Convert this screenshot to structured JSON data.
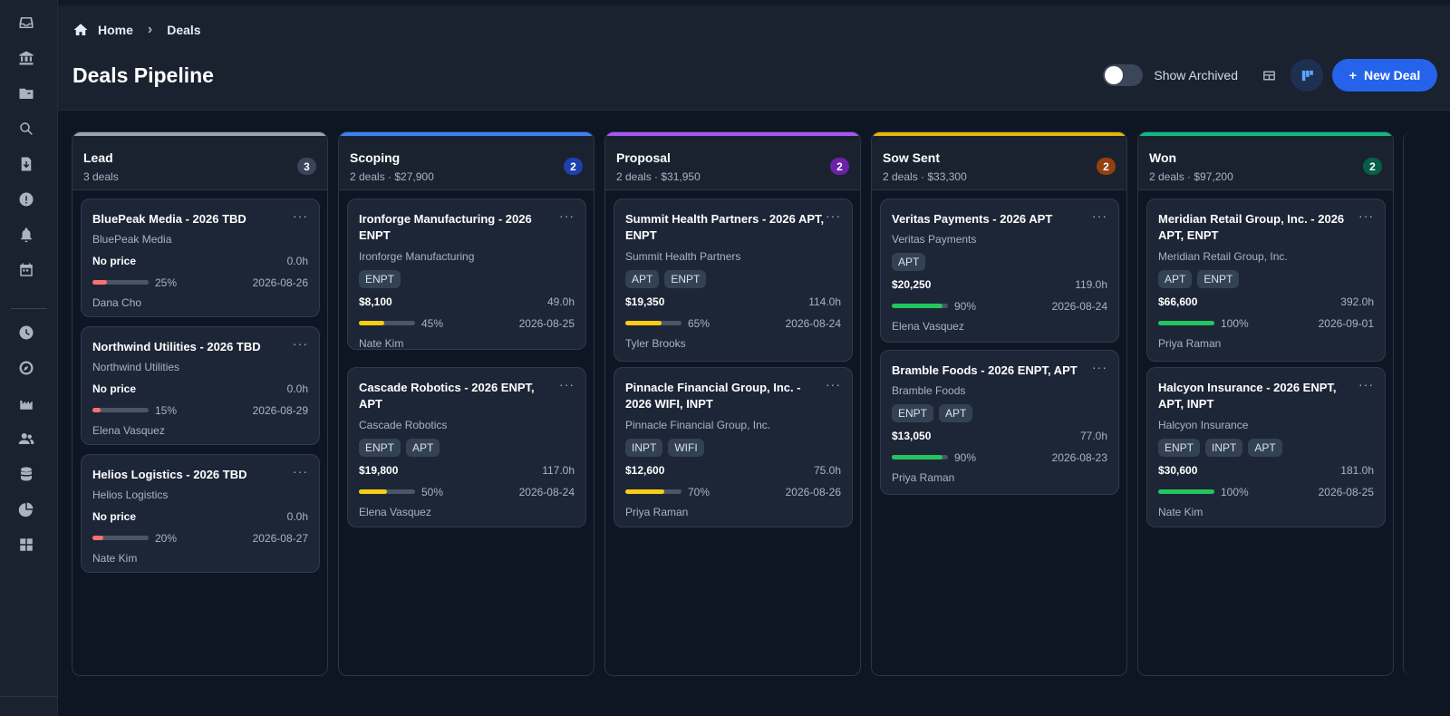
{
  "breadcrumb": {
    "home": "Home",
    "current": "Deals"
  },
  "page_title": "Deals Pipeline",
  "toolbar": {
    "show_archived": "Show Archived",
    "new_deal": "New Deal"
  },
  "columns": [
    {
      "title": "Lead",
      "meta": "3 deals",
      "count": "3",
      "accent": "#9aa3af",
      "badge": "#3b4658",
      "cards": [
        {
          "title": "BluePeak Media - 2026 TBD",
          "company": "BluePeak Media",
          "tags": [],
          "price": "No price",
          "hours": "0.0h",
          "progress": 25,
          "pct": "25%",
          "date": "2026-08-26",
          "owner": "Dana Cho"
        },
        {
          "title": "Northwind Utilities - 2026 TBD",
          "company": "Northwind Utilities",
          "tags": [],
          "price": "No price",
          "hours": "0.0h",
          "progress": 15,
          "pct": "15%",
          "date": "2026-08-29",
          "owner": "Elena Vasquez"
        },
        {
          "title": "Helios Logistics - 2026 TBD",
          "company": "Helios Logistics",
          "tags": [],
          "price": "No price",
          "hours": "0.0h",
          "progress": 20,
          "pct": "20%",
          "date": "2026-08-27",
          "owner": "Nate Kim"
        }
      ]
    },
    {
      "title": "Scoping",
      "meta": "2 deals  · $27,900",
      "count": "2",
      "accent": "#3b82f6",
      "badge": "#1e40af",
      "cards": [
        {
          "title": "Ironforge Manufacturing - 2026 ENPT",
          "company": "Ironforge Manufacturing",
          "tags": [
            "ENPT"
          ],
          "price": "$8,100",
          "hours": "49.0h",
          "progress": 45,
          "pct": "45%",
          "date": "2026-08-25",
          "owner": "Nate Kim"
        },
        {
          "title": "Cascade Robotics - 2026 ENPT, APT",
          "company": "Cascade Robotics",
          "tags": [
            "ENPT",
            "APT"
          ],
          "price": "$19,800",
          "hours": "117.0h",
          "progress": 50,
          "pct": "50%",
          "date": "2026-08-24",
          "owner": "Elena Vasquez"
        }
      ]
    },
    {
      "title": "Proposal",
      "meta": "2 deals  · $31,950",
      "count": "2",
      "accent": "#a855f7",
      "badge": "#6b21a8",
      "cards": [
        {
          "title": "Summit Health Partners - 2026 APT, ENPT",
          "company": "Summit Health Partners",
          "tags": [
            "APT",
            "ENPT"
          ],
          "price": "$19,350",
          "hours": "114.0h",
          "progress": 65,
          "pct": "65%",
          "date": "2026-08-24",
          "owner": "Tyler Brooks"
        },
        {
          "title": "Pinnacle Financial Group, Inc. - 2026 WIFI, INPT",
          "company": "Pinnacle Financial Group, Inc.",
          "tags": [
            "INPT",
            "WIFI"
          ],
          "price": "$12,600",
          "hours": "75.0h",
          "progress": 70,
          "pct": "70%",
          "date": "2026-08-26",
          "owner": "Priya Raman"
        }
      ]
    },
    {
      "title": "Sow Sent",
      "meta": "2 deals  · $33,300",
      "count": "2",
      "accent": "#eab308",
      "badge": "#92400e",
      "cards": [
        {
          "title": "Veritas Payments - 2026 APT",
          "company": "Veritas Payments",
          "tags": [
            "APT"
          ],
          "price": "$20,250",
          "hours": "119.0h",
          "progress": 90,
          "pct": "90%",
          "date": "2026-08-24",
          "owner": "Elena Vasquez"
        },
        {
          "title": "Bramble Foods - 2026 ENPT, APT",
          "company": "Bramble Foods",
          "tags": [
            "ENPT",
            "APT"
          ],
          "price": "$13,050",
          "hours": "77.0h",
          "progress": 90,
          "pct": "90%",
          "date": "2026-08-23",
          "owner": "Priya Raman"
        }
      ]
    },
    {
      "title": "Won",
      "meta": "2 deals  · $97,200",
      "count": "2",
      "accent": "#10b981",
      "badge": "#065f46",
      "cards": [
        {
          "title": "Meridian Retail Group, Inc. - 2026 APT, ENPT",
          "company": "Meridian Retail Group, Inc.",
          "tags": [
            "APT",
            "ENPT"
          ],
          "price": "$66,600",
          "hours": "392.0h",
          "progress": 100,
          "pct": "100%",
          "date": "2026-09-01",
          "owner": "Priya Raman"
        },
        {
          "title": "Halcyon Insurance - 2026 ENPT, APT, INPT",
          "company": "Halcyon Insurance",
          "tags": [
            "ENPT",
            "INPT",
            "APT"
          ],
          "price": "$30,600",
          "hours": "181.0h",
          "progress": 100,
          "pct": "100%",
          "date": "2026-08-25",
          "owner": "Nate Kim"
        }
      ]
    }
  ],
  "progress_colors": {
    "low": "#f87171",
    "mid": "#facc15",
    "high": "#22c55e"
  }
}
